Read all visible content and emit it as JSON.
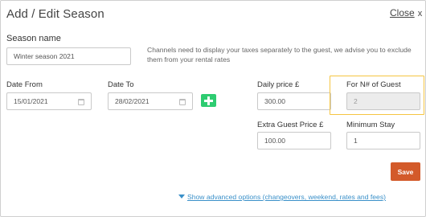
{
  "dialog": {
    "title": "Add / Edit Season",
    "close_label": "Close",
    "close_glyph": "x"
  },
  "season_name": {
    "label": "Season name",
    "value": "Winter season 2021"
  },
  "channels_note": "Channels need to display your taxes separately to the guest, we advise you to exclude them from your rental rates",
  "date_from": {
    "label": "Date From",
    "value": "15/01/2021",
    "icon": "calendar-icon"
  },
  "date_to": {
    "label": "Date To",
    "value": "28/02/2021",
    "icon": "calendar-icon"
  },
  "add_button_icon": "plus-icon",
  "daily_price": {
    "label": "Daily price £",
    "value": "300.00"
  },
  "for_guests": {
    "label": "For N# of Guest",
    "value": "2"
  },
  "extra_guest_price": {
    "label": "Extra Guest Price £",
    "value": "100.00"
  },
  "minimum_stay": {
    "label": "Minimum Stay",
    "value": "1"
  },
  "save_label": "Save",
  "advanced_link": "Show advanced options (changeovers, weekend, rates and fees)",
  "colors": {
    "accent_green": "#2ecc71",
    "save_orange": "#d35a2a",
    "link_blue": "#3a90c9",
    "highlight_yellow": "#f5c542"
  }
}
